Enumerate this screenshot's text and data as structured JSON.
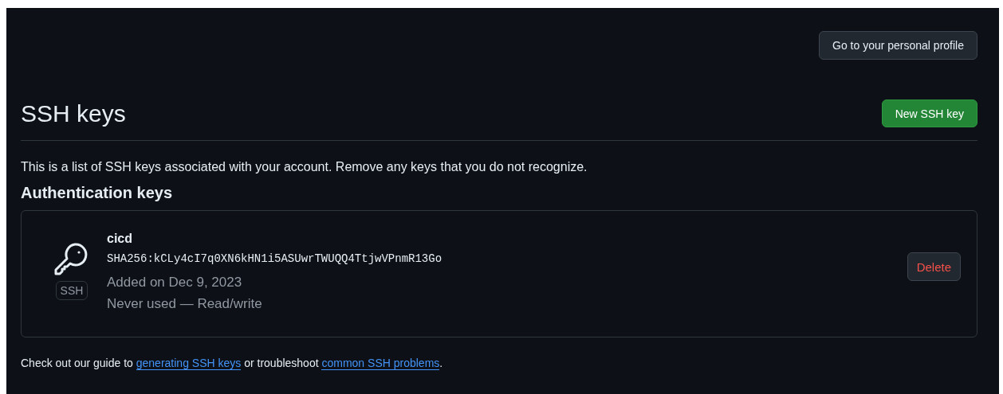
{
  "profile_button": "Go to your personal profile",
  "title": "SSH keys",
  "new_button": "New SSH key",
  "intro": "This is a list of SSH keys associated with your account. Remove any keys that you do not recognize.",
  "section_title": "Authentication keys",
  "keys": [
    {
      "badge": "SSH",
      "name": "cicd",
      "fingerprint": "SHA256:kCLy4cI7q0XN6kHN1i5ASUwrTWUQQ4TtjwVPnmR13Go",
      "added": "Added on Dec 9, 2023",
      "usage": "Never used — Read/write",
      "delete_label": "Delete"
    }
  ],
  "footer": [
    {
      "kind": "text",
      "text": "Check out our guide to "
    },
    {
      "kind": "link",
      "text": "generating SSH keys"
    },
    {
      "kind": "text",
      "text": " or troubleshoot "
    },
    {
      "kind": "link",
      "text": "common SSH problems"
    },
    {
      "kind": "text",
      "text": "."
    }
  ]
}
